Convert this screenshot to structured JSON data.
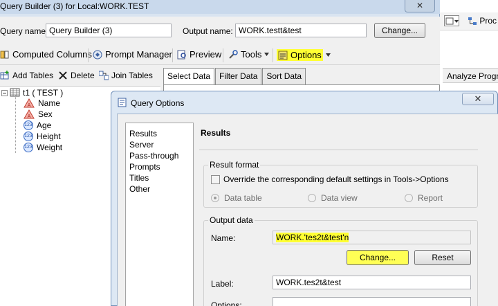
{
  "main_window": {
    "title": "Query Builder (3) for Local:WORK.TEST",
    "close": "✕",
    "query_name_label": "Query name:",
    "query_name_value": "Query Builder (3)",
    "output_name_label": "Output name:",
    "output_name_value": "WORK.testt&test",
    "change_label": "Change..."
  },
  "toolbar": {
    "computed_columns": "Computed Columns",
    "prompt_manager": "Prompt Manager",
    "preview": "Preview",
    "tools": "Tools",
    "options": "Options"
  },
  "table_toolbar": {
    "add_tables": "Add Tables",
    "delete": "Delete",
    "join_tables": "Join Tables"
  },
  "tabs": [
    "Select Data",
    "Filter Data",
    "Sort Data"
  ],
  "tree": {
    "root": "t1 ( TEST )",
    "columns": [
      {
        "name": "Name",
        "type": "char"
      },
      {
        "name": "Sex",
        "type": "char"
      },
      {
        "name": "Age",
        "type": "num"
      },
      {
        "name": "Height",
        "type": "num"
      },
      {
        "name": "Weight",
        "type": "num"
      }
    ]
  },
  "background_app": {
    "proc_label": "Proc",
    "analyze_label": "Analyze Progra"
  },
  "dialog": {
    "title": "Query Options",
    "close": "✕",
    "nav_items": [
      "Results",
      "Server",
      "Pass-through",
      "Prompts",
      "Titles",
      "Other"
    ],
    "section_title": "Results",
    "result_format": {
      "group_label": "Result format",
      "override_label": "Override the corresponding default settings in Tools->Options",
      "override_checked": false,
      "options": [
        "Data table",
        "Data view",
        "Report"
      ],
      "selected": "Data table"
    },
    "output_data": {
      "group_label": "Output data",
      "name_label": "Name:",
      "name_value": "WORK.'tes2t&test'n",
      "change_label": "Change...",
      "reset_label": "Reset",
      "label_label": "Label:",
      "label_value": "WORK.tes2t&test",
      "options_label": "Options:",
      "options_value": ""
    }
  },
  "colors": {
    "highlight": "#ffff33",
    "dialog_frame": "#dde8f4",
    "window_frame": "#d9e4f1"
  }
}
